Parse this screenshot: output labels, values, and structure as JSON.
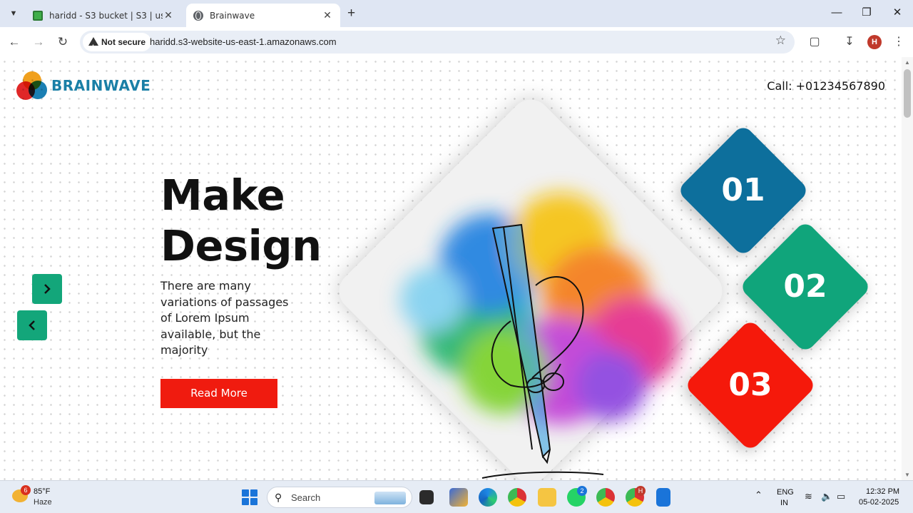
{
  "browser": {
    "tabs": [
      {
        "title": "haridd - S3 bucket | S3 | us-east-1",
        "active": false
      },
      {
        "title": "Brainwave",
        "active": true
      }
    ],
    "new_tab": "+",
    "security_label": "Not secure",
    "url": "haridd.s3-website-us-east-1.amazonaws.com",
    "profile_initial": "H"
  },
  "site": {
    "brand": "BRAINWAVE",
    "call": "Call: +01234567890",
    "headline_line1": "Make",
    "headline_line2": "Design",
    "description": "There are many variations of passages of Lorem Ipsum available, but the majority",
    "read_more": "Read More",
    "steps": [
      "01",
      "02",
      "03"
    ],
    "colors": {
      "blue": "#0d6f9c",
      "green": "#10a57b",
      "red": "#f5190b",
      "arrow": "#13a67a"
    }
  },
  "taskbar": {
    "weather_temp": "85°F",
    "weather_desc": "Haze",
    "weather_badge": "6",
    "search_label": "Search",
    "whatsapp_badge": "2",
    "chrome_badge": "H",
    "lang_line1": "ENG",
    "lang_line2": "IN",
    "time": "12:32 PM",
    "date": "05-02-2025"
  }
}
